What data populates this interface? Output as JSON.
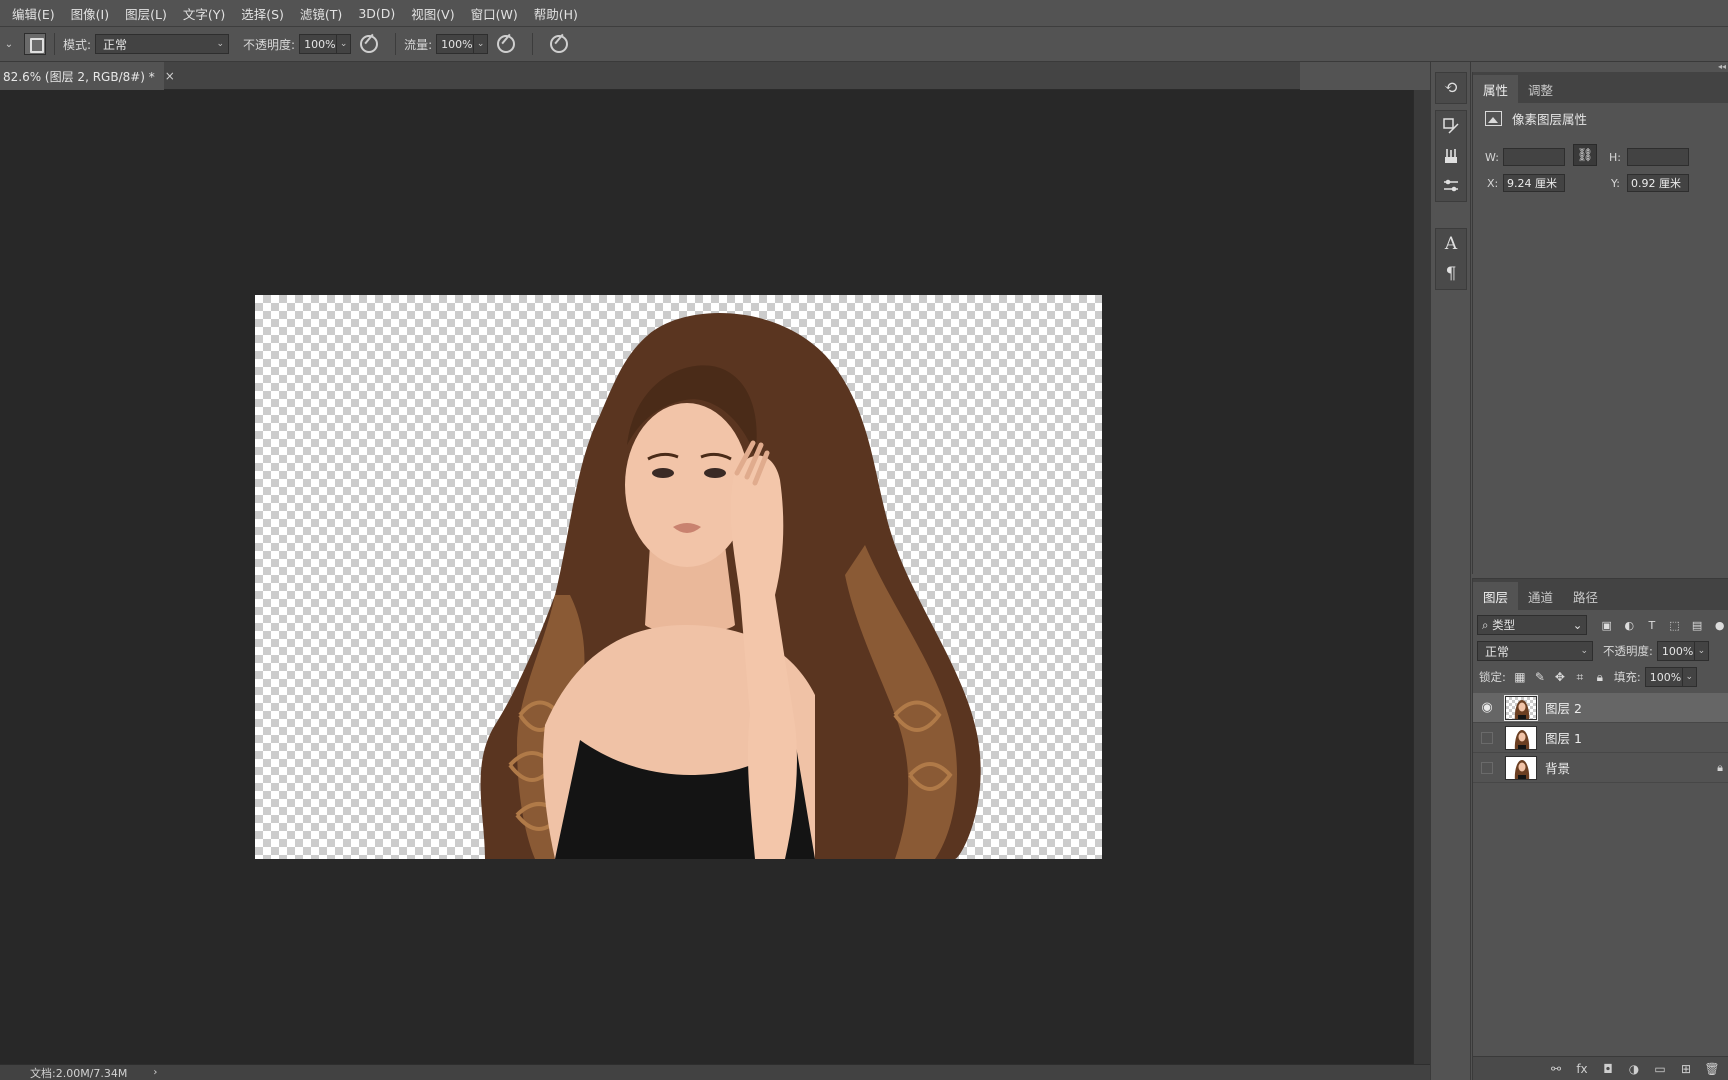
{
  "menu": [
    "编辑(E)",
    "图像(I)",
    "图层(L)",
    "文字(Y)",
    "选择(S)",
    "滤镜(T)",
    "3D(D)",
    "视图(V)",
    "窗口(W)",
    "帮助(H)"
  ],
  "options": {
    "mode_label": "模式:",
    "mode_value": "正常",
    "opacity_label": "不透明度:",
    "opacity_value": "100%",
    "flow_label": "流量:",
    "flow_value": "100%"
  },
  "document": {
    "tab_title": "82.6% (图层 2, RGB/8#) *",
    "close_glyph": "×"
  },
  "status": {
    "doc_info": "文档:2.00M/7.34M",
    "arrow": "›"
  },
  "dock": {
    "collapse": "◂◂",
    "history_glyph": "⟲",
    "char_glyph": "A",
    "para_glyph": "¶"
  },
  "properties": {
    "tabs": [
      "属性",
      "调整"
    ],
    "title": "像素图层属性",
    "w_label": "W:",
    "w_value": "",
    "h_label": "H:",
    "h_value": "",
    "x_label": "X:",
    "x_value": "9.24 厘米",
    "y_label": "Y:",
    "y_value": "0.92 厘米",
    "link_glyph": "⛓"
  },
  "layers_panel": {
    "tabs": [
      "图层",
      "通道",
      "路径"
    ],
    "kind_filter": "类型",
    "blend_mode": "正常",
    "opacity_label": "不透明度:",
    "opacity_value": "100%",
    "lock_label": "锁定:",
    "fill_label": "填充:",
    "fill_value": "100%",
    "layers": [
      {
        "name": "图层 2",
        "visible": true,
        "selected": true
      },
      {
        "name": "图层 1",
        "visible": false,
        "selected": false
      },
      {
        "name": "背景",
        "visible": false,
        "selected": false,
        "locked": true
      }
    ]
  },
  "colors": {
    "ui_panel": "#535353",
    "workspace": "#282828",
    "selected_layer": "#666666"
  }
}
